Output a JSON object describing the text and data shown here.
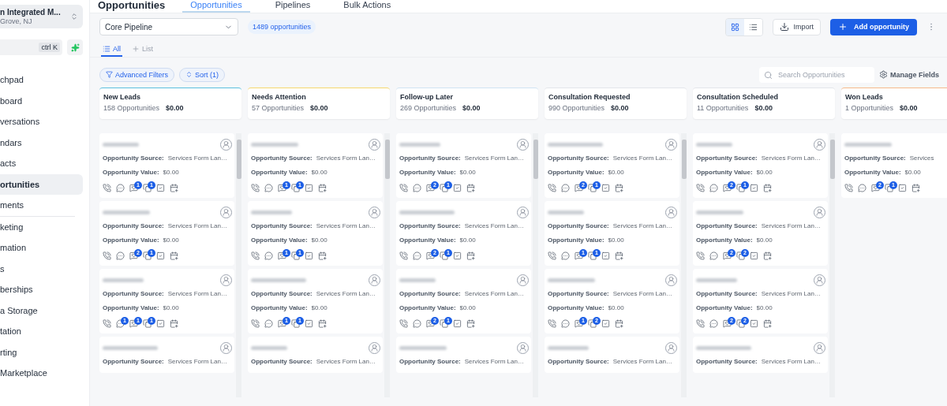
{
  "sidebar": {
    "account": {
      "name": "n Integrated M...",
      "location": "Grove, NJ"
    },
    "search_shortcut": "ctrl K",
    "groups": [
      [
        {
          "label": "chpad",
          "selected": false
        },
        {
          "label": "board",
          "selected": false
        },
        {
          "label": "versations",
          "selected": false
        },
        {
          "label": "ndars",
          "selected": false
        },
        {
          "label": "acts",
          "selected": false
        },
        {
          "label": "ortunities",
          "selected": true
        },
        {
          "label": "ments",
          "selected": false
        }
      ],
      [
        {
          "label": "keting",
          "selected": false
        },
        {
          "label": "mation",
          "selected": false
        },
        {
          "label": "s",
          "selected": false
        },
        {
          "label": "berships",
          "selected": false
        },
        {
          "label": "a Storage",
          "selected": false
        },
        {
          "label": "tation",
          "selected": false
        },
        {
          "label": "rting",
          "selected": false
        },
        {
          "label": "Marketplace",
          "selected": false
        }
      ]
    ]
  },
  "header": {
    "title": "Opportunities",
    "tabs": [
      {
        "label": "Opportunities",
        "selected": true
      },
      {
        "label": "Pipelines",
        "selected": false
      },
      {
        "label": "Bulk Actions",
        "selected": false
      }
    ]
  },
  "toolbar": {
    "pipeline": "Core Pipeline",
    "count": "1489 opportunities",
    "view_modes": [
      {
        "kind": "grid",
        "selected": true
      },
      {
        "kind": "list",
        "selected": false
      }
    ],
    "import": "Import",
    "add": "Add opportunity"
  },
  "views": [
    {
      "kind": "all",
      "label": "All",
      "selected": true
    },
    {
      "kind": "add",
      "label": "List",
      "selected": false
    }
  ],
  "filters": {
    "advanced": "Advanced Filters",
    "sort": "Sort (1)",
    "search_placeholder": "Search Opportunities",
    "manage": "Manage Fields"
  },
  "columns": [
    {
      "title": "New Leads",
      "count": "158 Opportunities",
      "value": "$0.00",
      "color": "#5bc0de",
      "scrollbar": true,
      "cards": [
        {
          "source_label": "Opportunity Source:",
          "source": "Services Form Lan…",
          "value_label": "Opportunity Value:",
          "value": "$0.00",
          "flag_count": "1",
          "doc_count": "1"
        },
        {
          "source_label": "Opportunity Source:",
          "source": "Services Form Lan…",
          "value_label": "Opportunity Value:",
          "value": "$0.00",
          "flag_count": "2",
          "doc_count": "1"
        },
        {
          "source_label": "Opportunity Source:",
          "source": "Services Form Lan…",
          "value_label": "Opportunity Value:",
          "value": "$0.00",
          "chat_count": "1",
          "flag_count": "1",
          "doc_count": "1"
        },
        {
          "source_label": "Opportunity Source:",
          "source": "Services Form Lan…"
        }
      ]
    },
    {
      "title": "Needs Attention",
      "count": "57 Opportunities",
      "value": "$0.00",
      "color": "#f5d76e",
      "scrollbar": true,
      "cards": [
        {
          "source_label": "Opportunity Source:",
          "source": "Services Form Lan…",
          "value_label": "Opportunity Value:",
          "value": "$0.00",
          "flag_count": "1",
          "doc_count": "1"
        },
        {
          "source_label": "Opportunity Source:",
          "source": "Services Form Lan…",
          "value_label": "Opportunity Value:",
          "value": "$0.00",
          "flag_count": "1",
          "doc_count": "1"
        },
        {
          "source_label": "Opportunity Source:",
          "source": "Services Form Lan…",
          "value_label": "Opportunity Value:",
          "value": "$0.00",
          "flag_count": "1",
          "doc_count": "1"
        },
        {
          "source_label": "Opportunity Source:",
          "source": "Services Form Lan…"
        }
      ]
    },
    {
      "title": "Follow-up Later",
      "count": "269 Opportunities",
      "value": "$0.00",
      "color": "#cfe3f3",
      "scrollbar": true,
      "cards": [
        {
          "source_label": "Opportunity Source:",
          "source": "Services Form Lan…",
          "value_label": "Opportunity Value:",
          "value": "$0.00",
          "flag_count": "2",
          "doc_count": "1"
        },
        {
          "source_label": "Opportunity Source:",
          "source": "Services Form Lan…",
          "value_label": "Opportunity Value:",
          "value": "$0.00",
          "flag_count": "2",
          "doc_count": "1"
        },
        {
          "source_label": "Opportunity Source:",
          "source": "Services Form Lan…",
          "value_label": "Opportunity Value:",
          "value": "$0.00",
          "flag_count": "2",
          "doc_count": "1"
        },
        {
          "source_label": "Opportunity Source:",
          "source": "Services Form Lan…"
        }
      ]
    },
    {
      "title": "Consultation Requested",
      "count": "990 Opportunities",
      "value": "$0.00",
      "color": "#e3e6ea",
      "scrollbar": true,
      "cards": [
        {
          "source_label": "Opportunity Source:",
          "source": "Services Form Lan…",
          "value_label": "Opportunity Value:",
          "value": "$0.00",
          "flag_count": "2",
          "doc_count": "1"
        },
        {
          "source_label": "Opportunity Source:",
          "source": "Services Form Lan…",
          "value_label": "Opportunity Value:",
          "value": "$0.00",
          "flag_count": "1",
          "doc_count": "1"
        },
        {
          "source_label": "Opportunity Source:",
          "source": "Services Form Lan…",
          "value_label": "Opportunity Value:",
          "value": "$0.00",
          "flag_count": "1",
          "doc_count": "2"
        },
        {
          "source_label": "Opportunity Source:",
          "source": "Services Form Lan…"
        }
      ]
    },
    {
      "title": "Consultation Scheduled",
      "count": "11 Opportunities",
      "value": "$0.00",
      "color": "#e3e6ea",
      "scrollbar": true,
      "cards": [
        {
          "source_label": "Opportunity Source:",
          "source": "Services Form Lan…",
          "value_label": "Opportunity Value:",
          "value": "$0.00",
          "flag_count": "2",
          "doc_count": "1"
        },
        {
          "source_label": "Opportunity Source:",
          "source": "Services Form Lan…",
          "value_label": "Opportunity Value:",
          "value": "$0.00",
          "flag_count": "2",
          "doc_count": "2"
        },
        {
          "source_label": "Opportunity Source:",
          "source": "Services Form Lan…",
          "value_label": "Opportunity Value:",
          "value": "$0.00",
          "flag_count": "2",
          "doc_count": "2"
        },
        {
          "source_label": "Opportunity Source:",
          "source": "Services Form Lan…"
        }
      ]
    },
    {
      "title": "Won Leads",
      "count": "1 Opportunities",
      "value": "$0.00",
      "color": "#f5b98a",
      "scrollbar": false,
      "cards": [
        {
          "source_label": "Opportunity Source:",
          "source": "Services",
          "value_label": "Opportunity Value:",
          "value": "$0.00",
          "flag_count": "2",
          "doc_count": "1"
        }
      ]
    }
  ]
}
